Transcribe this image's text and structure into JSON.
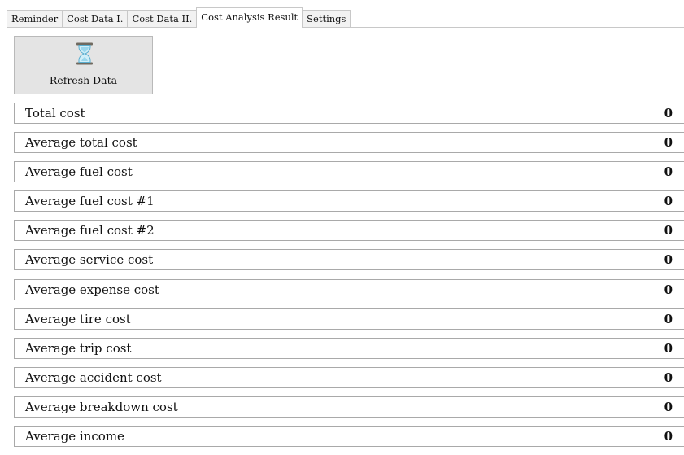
{
  "tabs": [
    {
      "label": "Reminder",
      "active": false
    },
    {
      "label": "Cost Data I.",
      "active": false
    },
    {
      "label": "Cost Data II.",
      "active": false
    },
    {
      "label": "Cost Analysis Result",
      "active": true
    },
    {
      "label": "Settings",
      "active": false
    }
  ],
  "refresh_button": {
    "label": "Refresh Data",
    "icon": "hourglass-icon"
  },
  "rows": [
    {
      "label": "Total cost",
      "value": "0"
    },
    {
      "label": "Average total cost",
      "value": "0"
    },
    {
      "label": "Average fuel cost",
      "value": "0"
    },
    {
      "label": "Average fuel cost #1",
      "value": "0"
    },
    {
      "label": "Average fuel cost #2",
      "value": "0"
    },
    {
      "label": "Average service cost",
      "value": "0"
    },
    {
      "label": "Average expense cost",
      "value": "0"
    },
    {
      "label": "Average tire cost",
      "value": "0"
    },
    {
      "label": "Average trip cost",
      "value": "0"
    },
    {
      "label": "Average accident cost",
      "value": "0"
    },
    {
      "label": "Average breakdown cost",
      "value": "0"
    },
    {
      "label": "Average income",
      "value": "0"
    }
  ],
  "colors": {
    "button_bg": "#e4e4e4",
    "border": "#a9a9a9",
    "hourglass_frame": "#6f6a60",
    "hourglass_glass": "#9ad6ec"
  }
}
